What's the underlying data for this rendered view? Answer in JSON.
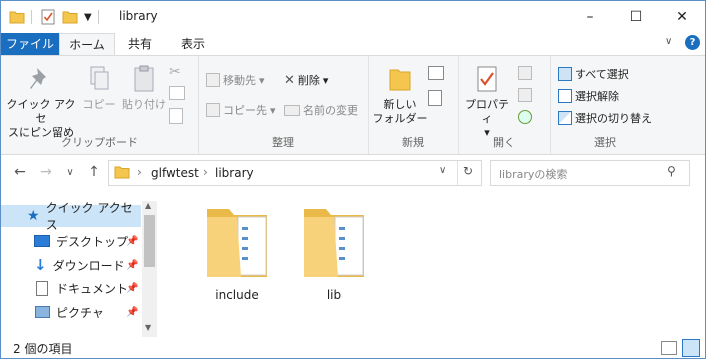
{
  "window": {
    "title": "library"
  },
  "window_controls": {
    "minimize": "–",
    "maximize": "☐",
    "close": "✕"
  },
  "ribbon_tabs": {
    "file": "ファイル",
    "home": "ホーム",
    "share": "共有",
    "view": "表示"
  },
  "ribbon": {
    "clipboard": {
      "group_label": "クリップボード",
      "pin_quick_access_line1": "クイック アクセ",
      "pin_quick_access_line2": "スにピン留め",
      "copy": "コピー",
      "paste": "貼り付け"
    },
    "organize": {
      "group_label": "整理",
      "move_to": "移動先",
      "copy_to": "コピー先",
      "delete": "削除",
      "rename": "名前の変更"
    },
    "new": {
      "group_label": "新規",
      "new_folder_line1": "新しい",
      "new_folder_line2": "フォルダー"
    },
    "open": {
      "group_label": "開く",
      "properties": "プロパティ"
    },
    "select": {
      "group_label": "選択",
      "select_all": "すべて選択",
      "select_none": "選択解除",
      "invert_selection": "選択の切り替え"
    }
  },
  "address": {
    "breadcrumb": [
      "glfwtest",
      "library"
    ],
    "separator": "›"
  },
  "search": {
    "placeholder": "libraryの検索"
  },
  "nav_pane": {
    "quick_access": "クイック アクセス",
    "items": [
      {
        "label": "デスクトップ",
        "icon": "desktop-icon"
      },
      {
        "label": "ダウンロード",
        "icon": "download-icon"
      },
      {
        "label": "ドキュメント",
        "icon": "document-icon"
      },
      {
        "label": "ピクチャ",
        "icon": "picture-icon"
      }
    ]
  },
  "files": [
    {
      "name": "include",
      "type": "folder"
    },
    {
      "name": "lib",
      "type": "folder"
    }
  ],
  "status": {
    "item_count": "2 個の項目"
  },
  "colors": {
    "accent": "#1a6ec0",
    "selection": "#cce4f7",
    "folder": "#f4c64d"
  }
}
